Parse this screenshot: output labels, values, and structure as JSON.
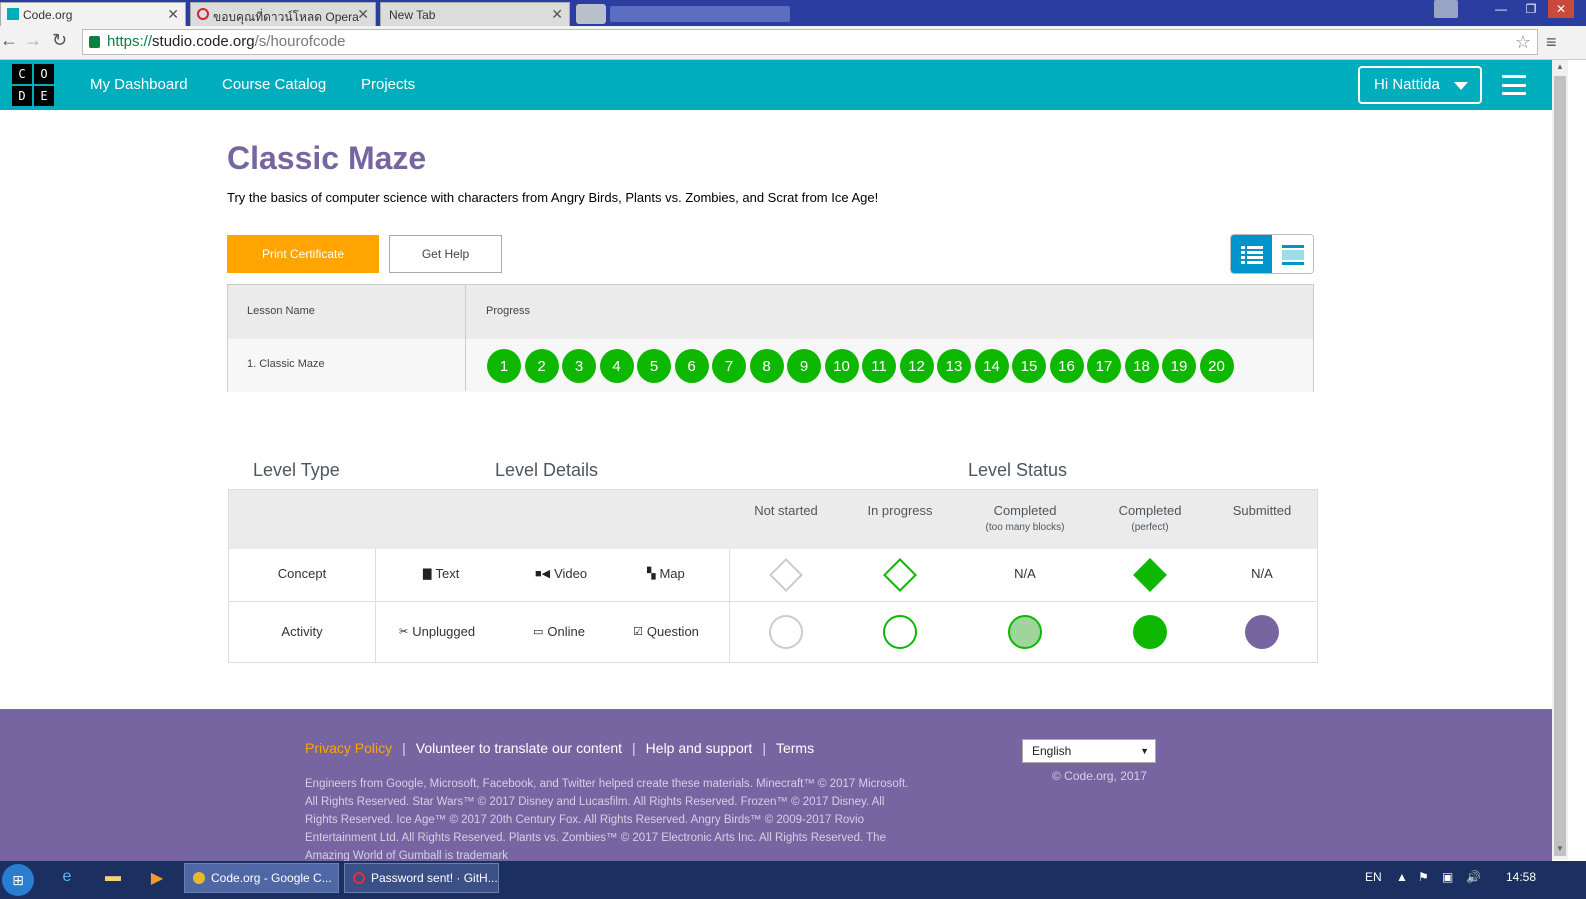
{
  "browser": {
    "tabs": [
      {
        "title": "Code.org",
        "active": true
      },
      {
        "title": "ขอบคุณที่ดาวน์โหลด Opera",
        "active": false
      },
      {
        "title": "New Tab",
        "active": false
      }
    ],
    "url": {
      "scheme": "https://",
      "host": "studio.code.org",
      "path": "/s/hourofcode"
    }
  },
  "header": {
    "logo_letters": [
      "C",
      "O",
      "D",
      "E"
    ],
    "nav": [
      "My Dashboard",
      "Course Catalog",
      "Projects"
    ],
    "user_greeting": "Hi Nattida",
    "brand_color": "#00adbc"
  },
  "course": {
    "title": "Classic Maze",
    "description": "Try the basics of computer science with characters from Angry Birds, Plants vs. Zombies, and Scrat from Ice Age!",
    "print_certificate_label": "Print Certificate",
    "get_help_label": "Get Help"
  },
  "progress_table": {
    "col_lesson": "Lesson Name",
    "col_progress": "Progress",
    "lesson_name": "1. Classic Maze",
    "levels": [
      "1",
      "2",
      "3",
      "4",
      "5",
      "6",
      "7",
      "8",
      "9",
      "10",
      "11",
      "12",
      "13",
      "14",
      "15",
      "16",
      "17",
      "18",
      "19",
      "20"
    ],
    "level_color": "#0eb800"
  },
  "key": {
    "level_type": "Level Type",
    "level_details": "Level Details",
    "level_status": "Level Status",
    "statuses": [
      {
        "label": "Not started",
        "sub": ""
      },
      {
        "label": "In progress",
        "sub": ""
      },
      {
        "label": "Completed",
        "sub": "(too many blocks)"
      },
      {
        "label": "Completed",
        "sub": "(perfect)"
      },
      {
        "label": "Submitted",
        "sub": ""
      }
    ],
    "concept": {
      "label": "Concept",
      "details": [
        "Text",
        "Video",
        "Map"
      ],
      "na": "N/A"
    },
    "activity": {
      "label": "Activity",
      "details": [
        "Unplugged",
        "Online",
        "Question"
      ]
    },
    "colors": {
      "not_started": "#cccccc",
      "perfect": "#0eb800",
      "too_many": "#9fd49c",
      "submitted": "#7665a0"
    }
  },
  "footer": {
    "links": [
      "Privacy Policy",
      "Volunteer to translate our content",
      "Help and support",
      "Terms"
    ],
    "copy": "Engineers from Google, Microsoft, Facebook, and Twitter helped create these materials. Minecraft™ © 2017 Microsoft. All Rights Reserved. Star Wars™ © 2017 Disney and Lucasfilm. All Rights Reserved. Frozen™ © 2017 Disney. All Rights Reserved. Ice Age™ © 2017 20th Century Fox. All Rights Reserved. Angry Birds™ © 2009-2017 Rovio Entertainment Ltd. All Rights Reserved. Plants vs. Zombies™ © 2017 Electronic Arts Inc. All Rights Reserved. The Amazing World of Gumball is trademark",
    "language": "English",
    "copyright": "© Code.org, 2017",
    "color": "#7665a0"
  },
  "taskbar": {
    "items": [
      "Code.org - Google C...",
      "Password sent! · GitH..."
    ],
    "lang": "EN",
    "time": "14:58"
  }
}
